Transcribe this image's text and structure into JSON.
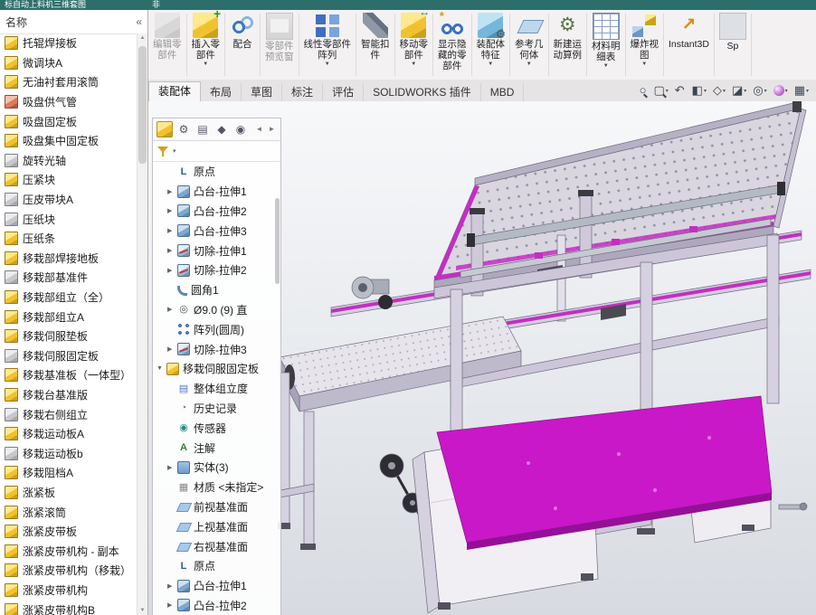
{
  "window": {
    "title": "标自动上料机三维套图",
    "title2": "非"
  },
  "colors": {
    "accent_magenta": "#c818c8",
    "titlebar_teal": "#2e6e6a",
    "part_icon_yellow": "#f2c12e",
    "frame_lavender": "#d6d1e0"
  },
  "ribbon": {
    "buttons": [
      {
        "label": "编辑零\n部件",
        "icon": "edit-component-icon",
        "cls": "ic-edit",
        "state": "disabled",
        "caret": ""
      },
      {
        "label": "插入零\n部件",
        "icon": "insert-component-icon",
        "cls": "ic-insert",
        "state": "",
        "caret": "▼"
      },
      {
        "label": "配合",
        "icon": "mate-icon",
        "cls": "ic-mate",
        "state": "",
        "caret": ""
      },
      {
        "label": "零部件\n预览窗",
        "icon": "component-preview-icon",
        "cls": "ic-preview",
        "state": "disabled",
        "caret": ""
      },
      {
        "label": "线性零部件\n阵列",
        "icon": "linear-component-pattern-icon",
        "cls": "ic-pattern",
        "state": "",
        "caret": "▼"
      },
      {
        "label": "智能扣\n件",
        "icon": "smart-fasteners-icon",
        "cls": "ic-fastener",
        "state": "",
        "caret": ""
      },
      {
        "label": "移动零\n部件",
        "icon": "move-component-icon",
        "cls": "ic-move",
        "state": "",
        "caret": "▼"
      },
      {
        "label": "显示隐\n藏的零\n部件",
        "icon": "show-hidden-components-icon",
        "cls": "ic-hidden",
        "state": "",
        "caret": ""
      },
      {
        "label": "装配体\n特征",
        "icon": "assembly-features-icon",
        "cls": "ic-asmfeat",
        "state": "",
        "caret": "▼"
      },
      {
        "label": "参考几\n何体",
        "icon": "reference-geometry-icon",
        "cls": "ic-refgeo",
        "state": "",
        "caret": "▼"
      },
      {
        "label": "新建运\n动算例",
        "icon": "new-motion-study-icon",
        "cls": "ic-motion",
        "state": "",
        "caret": ""
      },
      {
        "label": "材料明\n细表",
        "icon": "bill-of-materials-icon",
        "cls": "ic-bom",
        "state": "",
        "caret": "▼"
      },
      {
        "label": "爆炸视\n图",
        "icon": "exploded-view-icon",
        "cls": "ic-explode",
        "state": "",
        "caret": "▼"
      },
      {
        "label": "Instant3D",
        "icon": "instant3d-icon",
        "cls": "ic-instant",
        "state": "",
        "caret": ""
      },
      {
        "label": "Sp",
        "icon": "partial-button-icon",
        "cls": "ic-sp",
        "state": "",
        "caret": ""
      }
    ]
  },
  "tabs": {
    "items": [
      {
        "label": "装配体",
        "state": "active"
      },
      {
        "label": "布局",
        "state": ""
      },
      {
        "label": "草图",
        "state": ""
      },
      {
        "label": "标注",
        "state": ""
      },
      {
        "label": "评估",
        "state": ""
      },
      {
        "label": "SOLIDWORKS 插件",
        "state": ""
      },
      {
        "label": "MBD",
        "state": ""
      }
    ]
  },
  "headsup": {
    "icons": [
      {
        "name": "zoom-fit-icon",
        "glyph": "○",
        "cls": "g-zoom",
        "caret": ""
      },
      {
        "name": "zoom-area-icon",
        "glyph": "▢",
        "cls": "g-zoom",
        "caret": "▾"
      },
      {
        "name": "previous-view-icon",
        "glyph": "↶",
        "cls": "g-prev",
        "caret": ""
      },
      {
        "name": "section-view-icon",
        "glyph": "◧",
        "cls": "g-section",
        "caret": "▾"
      },
      {
        "name": "view-orientation-icon",
        "glyph": "◇",
        "cls": "g-orient",
        "caret": "▾"
      },
      {
        "name": "display-style-icon",
        "glyph": "◪",
        "cls": "g-style",
        "caret": "▾"
      },
      {
        "name": "hide-show-items-icon",
        "glyph": "◎",
        "cls": "g-hide",
        "caret": "▾"
      },
      {
        "name": "edit-appearance-icon",
        "glyph": "",
        "cls": "g-ball",
        "caret": "▾"
      },
      {
        "name": "apply-scene-icon",
        "glyph": "▦",
        "cls": "g-scene",
        "caret": "▾"
      }
    ]
  },
  "left_panel": {
    "header": "名称",
    "collapse_glyph": "«",
    "items": [
      {
        "label": "托辊焊接板",
        "cls": ""
      },
      {
        "label": "微调块A",
        "cls": ""
      },
      {
        "label": "无油衬套用滚筒",
        "cls": ""
      },
      {
        "label": "吸盘供气管",
        "cls": "pi-red"
      },
      {
        "label": "吸盘固定板",
        "cls": ""
      },
      {
        "label": "吸盘集中固定板",
        "cls": ""
      },
      {
        "label": "旋转光轴",
        "cls": "pi-gray"
      },
      {
        "label": "压紧块",
        "cls": ""
      },
      {
        "label": "压皮带块A",
        "cls": "pi-gray"
      },
      {
        "label": "压纸块",
        "cls": "pi-gray"
      },
      {
        "label": "压纸条",
        "cls": ""
      },
      {
        "label": "移栽部焊接地板",
        "cls": ""
      },
      {
        "label": "移栽部基准件",
        "cls": "pi-gray"
      },
      {
        "label": "移栽部组立（全）",
        "cls": ""
      },
      {
        "label": "移栽部组立A",
        "cls": ""
      },
      {
        "label": "移栽伺服垫板",
        "cls": ""
      },
      {
        "label": "移栽伺服固定板",
        "cls": "pi-gray"
      },
      {
        "label": "移栽基准板（一体型）",
        "cls": ""
      },
      {
        "label": "移栽台基准版",
        "cls": ""
      },
      {
        "label": "移栽右侧组立",
        "cls": "pi-gray"
      },
      {
        "label": "移栽运动板A",
        "cls": ""
      },
      {
        "label": "移栽运动板b",
        "cls": "pi-gray"
      },
      {
        "label": "移栽阻档A",
        "cls": ""
      },
      {
        "label": "涨紧板",
        "cls": ""
      },
      {
        "label": "涨紧滚筒",
        "cls": ""
      },
      {
        "label": "涨紧皮带板",
        "cls": ""
      },
      {
        "label": "涨紧皮带机构 - 副本",
        "cls": ""
      },
      {
        "label": "涨紧皮带机构（移栽）",
        "cls": ""
      },
      {
        "label": "涨紧皮带机构",
        "cls": ""
      },
      {
        "label": "涨紧皮带机构B",
        "cls": ""
      }
    ]
  },
  "feature_tree": {
    "tabs": [
      {
        "name": "featuremanager-tab-icon",
        "glyph": "",
        "cls": "ttab-asm"
      },
      {
        "name": "propertymanager-tab-icon",
        "glyph": "⚙",
        "cls": ""
      },
      {
        "name": "configurationmanager-tab-icon",
        "glyph": "▤",
        "cls": ""
      },
      {
        "name": "dimxpertmanager-tab-icon",
        "glyph": "◆",
        "cls": ""
      },
      {
        "name": "displaymanager-tab-icon",
        "glyph": "◉",
        "cls": ""
      },
      {
        "name": "scroll-left-icon",
        "glyph": "◄",
        "cls": "tarrow push"
      },
      {
        "name": "scroll-right-icon",
        "glyph": "►",
        "cls": "tarrow"
      }
    ],
    "items": [
      {
        "label": "原点",
        "icon": "origin-icon",
        "cls": "ti-origin",
        "arrow": "",
        "ind": "ind1"
      },
      {
        "label": "凸台-拉伸1",
        "icon": "boss-extrude-icon",
        "cls": "ti-boss",
        "arrow": "▶",
        "ind": "ind1"
      },
      {
        "label": "凸台-拉伸2",
        "icon": "boss-extrude-icon",
        "cls": "ti-boss",
        "arrow": "▶",
        "ind": "ind1"
      },
      {
        "label": "凸台-拉伸3",
        "icon": "boss-extrude-icon",
        "cls": "ti-boss",
        "arrow": "▶",
        "ind": "ind1"
      },
      {
        "label": "切除-拉伸1",
        "icon": "cut-extrude-icon",
        "cls": "ti-cut",
        "arrow": "▶",
        "ind": "ind1"
      },
      {
        "label": "切除-拉伸2",
        "icon": "cut-extrude-icon",
        "cls": "ti-cut",
        "arrow": "▶",
        "ind": "ind1"
      },
      {
        "label": "圆角1",
        "icon": "fillet-icon",
        "cls": "ti-fillet",
        "arrow": "",
        "ind": "ind1"
      },
      {
        "label": "Ø9.0 (9) 直",
        "icon": "hole-icon",
        "cls": "ti-hole",
        "arrow": "▶",
        "ind": "ind1"
      },
      {
        "label": "阵列(圆周)",
        "icon": "circular-pattern-icon",
        "cls": "ti-pattern",
        "arrow": "",
        "ind": "ind1"
      },
      {
        "label": "切除-拉伸3",
        "icon": "cut-extrude-icon",
        "cls": "ti-cut",
        "arrow": "▶",
        "ind": "ind1"
      },
      {
        "label": "移栽伺服固定板",
        "icon": "component-icon",
        "cls": "ti-part",
        "arrow": "▼",
        "ind": "ind0"
      },
      {
        "label": "整体组立度",
        "icon": "configuration-icon",
        "cls": "ti-config",
        "arrow": "",
        "ind": "ind1"
      },
      {
        "label": "历史记录",
        "icon": "history-icon",
        "cls": "ti-history",
        "arrow": "",
        "ind": "ind1"
      },
      {
        "label": "传感器",
        "icon": "sensors-icon",
        "cls": "ti-sensor",
        "arrow": "",
        "ind": "ind1"
      },
      {
        "label": "注解",
        "icon": "annotations-icon",
        "cls": "ti-annot",
        "arrow": "",
        "ind": "ind1"
      },
      {
        "label": "实体(3)",
        "icon": "solid-bodies-folder-icon",
        "cls": "ti-bodies",
        "arrow": "▶",
        "ind": "ind1"
      },
      {
        "label": "材质 <未指定>",
        "icon": "material-icon",
        "cls": "ti-material",
        "arrow": "",
        "ind": "ind1"
      },
      {
        "label": "前视基准面",
        "icon": "plane-icon",
        "cls": "ti-plane",
        "arrow": "",
        "ind": "ind1"
      },
      {
        "label": "上视基准面",
        "icon": "plane-icon",
        "cls": "ti-plane",
        "arrow": "",
        "ind": "ind1"
      },
      {
        "label": "右视基准面",
        "icon": "plane-icon",
        "cls": "ti-plane",
        "arrow": "",
        "ind": "ind1"
      },
      {
        "label": "原点",
        "icon": "origin-icon",
        "cls": "ti-origin",
        "arrow": "",
        "ind": "ind1"
      },
      {
        "label": "凸台-拉伸1",
        "icon": "boss-extrude-icon",
        "cls": "ti-boss",
        "arrow": "▶",
        "ind": "ind1"
      },
      {
        "label": "凸台-拉伸2",
        "icon": "boss-extrude-icon",
        "cls": "ti-boss",
        "arrow": "▶",
        "ind": "ind1"
      }
    ]
  }
}
